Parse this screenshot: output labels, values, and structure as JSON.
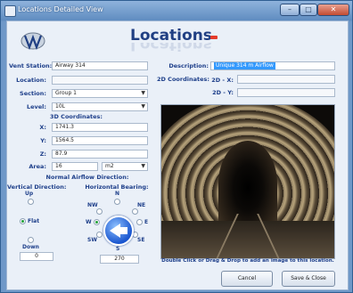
{
  "window": {
    "title": "Locations Detailed View",
    "controls": {
      "minimize": "–",
      "maximize": "□",
      "close": "✕"
    }
  },
  "header": {
    "title": "Locations"
  },
  "form": {
    "vent_station": {
      "label": "Vent Station:",
      "value": "Airway 314"
    },
    "location": {
      "label": "Location:",
      "value": ""
    },
    "section": {
      "label": "Section:",
      "value": "Group 1"
    },
    "level": {
      "label": "Level:",
      "value": "10L"
    },
    "coords3d": {
      "label": "3D Coordinates:",
      "x": {
        "label": "X:",
        "value": "1741.3"
      },
      "y": {
        "label": "Y:",
        "value": "1564.5"
      },
      "z": {
        "label": "Z:",
        "value": "87.9"
      }
    },
    "area": {
      "label": "Area:",
      "value": "16",
      "unit": "m2"
    },
    "airflow": {
      "label": "Normal Airflow Direction:",
      "vertical": {
        "label": "Vertical Direction:",
        "up": "Up",
        "flat": "Flat",
        "down": "Down",
        "selected": "flat",
        "value": "0"
      },
      "horizontal": {
        "label": "Horizontal Bearing:",
        "n": "N",
        "ne": "NE",
        "e": "E",
        "se": "SE",
        "s": "S",
        "sw": "SW",
        "w": "W",
        "nw": "NW",
        "selected": "w",
        "value": "270"
      }
    },
    "description": {
      "label": "Description:",
      "value": "Unique 314 m Airflow"
    },
    "coords2d": {
      "label": "2D Coordinates:",
      "x": {
        "label": "2D - X:",
        "value": ""
      },
      "y": {
        "label": "2D - Y:",
        "value": ""
      }
    }
  },
  "image_hint": "Double Click or Drag & Drop to add an image to this location.",
  "buttons": {
    "cancel": "Cancel",
    "save_close": "Save & Close"
  },
  "icons": [
    "app-icon",
    "logo-icon",
    "chevron-down-icon",
    "compass-arrow-icon"
  ],
  "colors": {
    "accent": "#203f83",
    "selection": "#3399ff",
    "alert": "#e53b2a",
    "radio_on": "#22a13a"
  }
}
